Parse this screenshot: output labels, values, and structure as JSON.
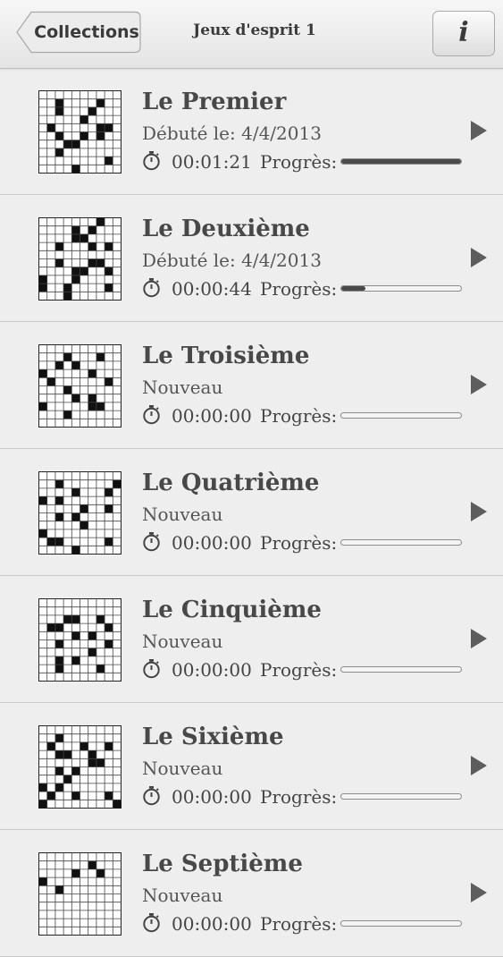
{
  "navbar": {
    "back_label": "Collections",
    "title": "Jeux d'esprit 1",
    "info_label": "i"
  },
  "progress_prefix": "Progrès:",
  "puzzles": [
    {
      "name": "Le Premier",
      "status": "Débuté le: 4/4/2013",
      "time": "00:01:21",
      "progress": 1.0,
      "cells": "0000000000,0010000100,0010001000,0000010000,0100000110,0010010100,0001100000,0010000000,0000000010,0000100000"
    },
    {
      "name": "Le Deuxième",
      "status": "Débuté le: 4/4/2013",
      "time": "00:00:44",
      "progress": 0.2,
      "cells": "0000000100,0000101000,0000110000,0010001010,0000000000,0010001100,0000110010,1000100000,1001000010,0001000000"
    },
    {
      "name": "Le Troisième",
      "status": "Nouveau",
      "time": "00:00:00",
      "progress": 0.0,
      "cells": "0000000000,0001000100,0010100000,1000001000,0100000010,0001000000,0000101000,1000001100,0001000000,0000000000"
    },
    {
      "name": "Le Quatrième",
      "status": "Nouveau",
      "time": "00:00:00",
      "progress": 0.0,
      "cells": "0000000000,0010000001,0000100010,1010000000,0000010010,0010100000,0000010000,1000000000,0110000010,0000100000"
    },
    {
      "name": "Le Cinquième",
      "status": "Nouveau",
      "time": "00:00:00",
      "progress": 0.0,
      "cells": "0000000000,0000000000,0001100100,0110000010,0000101000,0010000010,0000001000,0010100000,0010000100,0000000000"
    },
    {
      "name": "Le Sixième",
      "status": "Nouveau",
      "time": "00:00:00",
      "progress": 0.0,
      "cells": "0000000000,0010000000,0100010010,0011001000,0000001100,0010100000,0001000000,1010000000,0100100010,1000000001"
    },
    {
      "name": "Le Septième",
      "status": "Nouveau",
      "time": "00:00:00",
      "progress": 0.0,
      "cells": "0000000000,0000001000,0000100100,1000000000,0010000000,0000000000,0000000000,0000000000,0000000000,0000000000"
    }
  ]
}
